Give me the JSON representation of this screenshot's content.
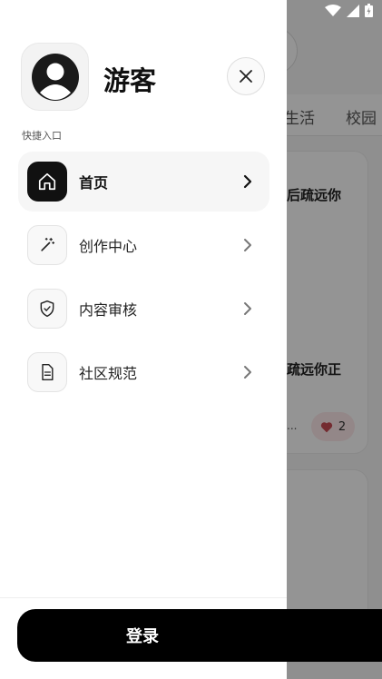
{
  "status_bar": {
    "icons": [
      "wifi-icon",
      "signal-icon",
      "battery-icon"
    ]
  },
  "background": {
    "tabs": [
      "生活",
      "校园"
    ],
    "card1_text": "后疏远你",
    "card2_text": "疏远你正",
    "card2_meta": "...",
    "like_count": "2"
  },
  "drawer": {
    "user_name": "游客",
    "section_label": "快捷入口",
    "menu": [
      {
        "label": "首页",
        "icon": "home-icon",
        "active": true
      },
      {
        "label": "创作中心",
        "icon": "magic-wand-icon",
        "active": false
      },
      {
        "label": "内容审核",
        "icon": "shield-check-icon",
        "active": false
      },
      {
        "label": "社区规范",
        "icon": "document-icon",
        "active": false
      }
    ],
    "login_label": "登录"
  },
  "colors": {
    "accent": "#000000",
    "like_heart": "#c94a53",
    "overlay": "rgba(0,0,0,0.42)"
  }
}
